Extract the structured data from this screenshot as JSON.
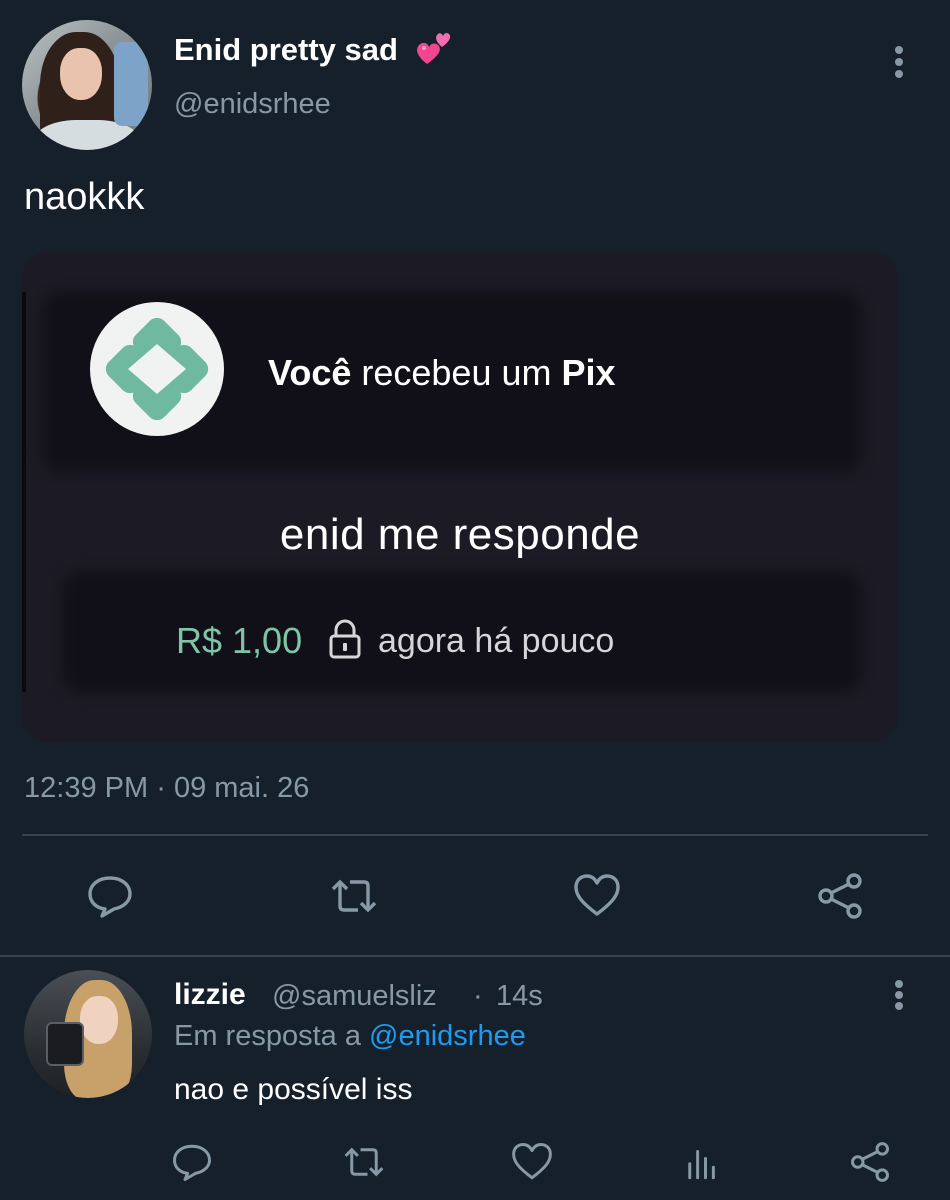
{
  "tweet": {
    "author": {
      "display_name": "Enid pretty sad",
      "name_emoji": "two-hearts-emoji",
      "handle": "@enidsrhee"
    },
    "text": "naokkk",
    "media": {
      "pix_title_prefix": "Você",
      "pix_title_middle": " recebeu um ",
      "pix_title_suffix": "Pix",
      "message": "enid me responde",
      "amount": "R$ 1,00",
      "time": "agora há pouco",
      "accent_color": "#7fc4a6",
      "pix_logo_color": "#6fb9a0"
    },
    "time": "12:39 PM",
    "separator": "·",
    "date": "09 mai. 26",
    "actions": [
      "reply-icon",
      "retweet-icon",
      "like-icon",
      "share-icon"
    ]
  },
  "reply": {
    "author": {
      "display_name": "lizzie",
      "handle": "@samuelsliz",
      "separator": "·",
      "age": "14s"
    },
    "reply_to_prefix": "Em resposta a ",
    "reply_to_mention": "@enidsrhee",
    "text": "nao e possível iss",
    "actions": [
      "reply-icon",
      "retweet-icon",
      "like-icon",
      "analytics-icon",
      "share-icon"
    ]
  },
  "colors": {
    "background": "#15202b",
    "secondary_text": "#8899a6",
    "mention": "#1d9bf0",
    "divider": "#38444d"
  }
}
